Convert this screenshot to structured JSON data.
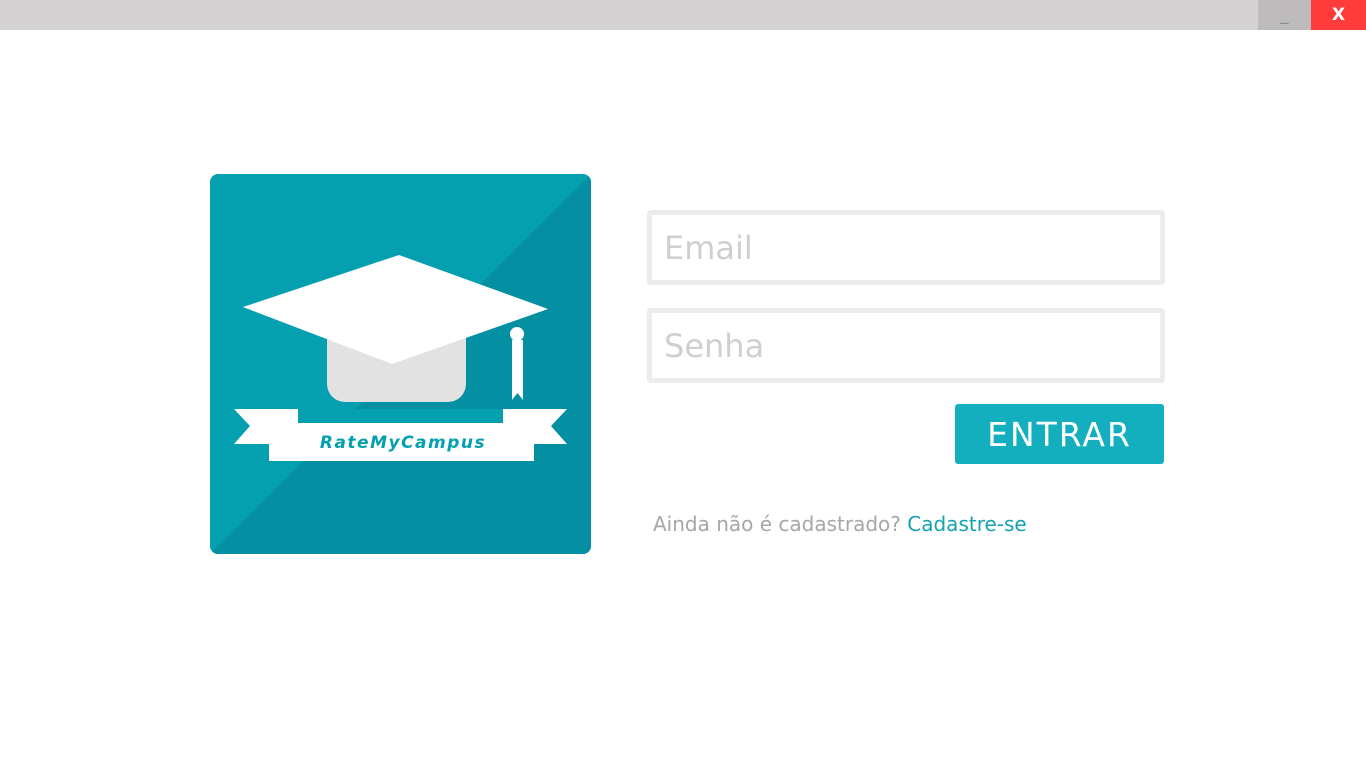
{
  "window": {
    "minimize_label": "_",
    "close_label": "X"
  },
  "logo": {
    "text": "RateMyCampus",
    "colors": {
      "background": "#04a0b0",
      "shadow": "#0490a2",
      "cap": "#ffffff",
      "cap_base": "#e2e2e2",
      "text": "#04a0b0"
    }
  },
  "login": {
    "email_placeholder": "Email",
    "password_placeholder": "Senha",
    "submit_label": "ENTRAR"
  },
  "signup": {
    "prompt": "Ainda não é cadastrado?",
    "link_label": "Cadastre-se"
  },
  "colors": {
    "accent": "#14afbe",
    "titlebar": "#d4d2d3",
    "close": "#ff3b3b"
  }
}
